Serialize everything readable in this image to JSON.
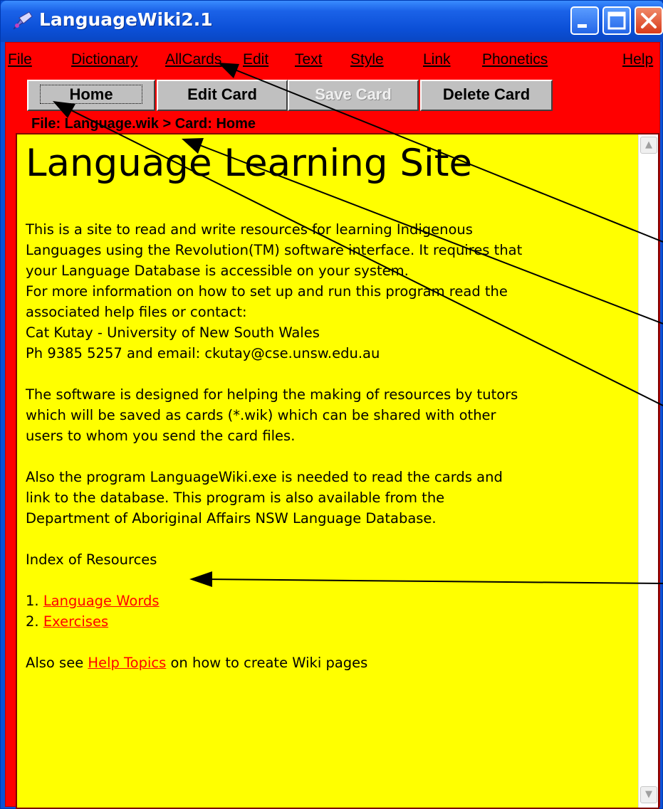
{
  "window": {
    "title": "LanguageWiki2.1",
    "colors": {
      "titlebar": "#0b4fd6",
      "client": "#ff0000",
      "card": "#ffff00",
      "link": "#ff0000"
    }
  },
  "icons": {
    "app": "app-icon",
    "minimize": "minimize-icon",
    "maximize": "maximize-icon",
    "close": "close-icon",
    "scroll_up": "scroll-up-arrow-icon",
    "scroll_down": "scroll-down-arrow-icon"
  },
  "menu": [
    {
      "label": "File"
    },
    {
      "label": "Dictionary"
    },
    {
      "label": "AllCards"
    },
    {
      "label": "Edit"
    },
    {
      "label": "Text"
    },
    {
      "label": "Style"
    },
    {
      "label": "Link"
    },
    {
      "label": "Phonetics"
    },
    {
      "label": "Help"
    }
  ],
  "toolbar": {
    "home": "Home",
    "edit_card": "Edit Card",
    "save_card": "Save Card",
    "delete_card": "Delete Card"
  },
  "breadcrumb": "File: Language.wik > Card: Home",
  "card": {
    "heading": "Language Learning Site",
    "lines": [
      "This is a site to read and write resources for learning Indigenous",
      "Languages using the Revolution(TM) software interface. It requires that",
      "your Language Database is accessible on your system.",
      "For more information on how to set up and run this program read the",
      "associated help files or contact:",
      "Cat Kutay - University of New South Wales",
      "Ph 9385 5257 and email: ckutay@cse.unsw.edu.au",
      "The software is designed for helping the making of resources by tutors",
      "which will be saved as cards (*.wik) which can be shared with other",
      "users to whom you send the card files.",
      "Also the program LanguageWiki.exe is needed to read the cards and",
      "link to the database. This program is also available from the",
      "Department of Aboriginal Affairs NSW Language Database.",
      "Index of Resources"
    ],
    "index": [
      {
        "number": "1.",
        "link": "Language Words"
      },
      {
        "number": "2.",
        "link": "Exercises"
      }
    ],
    "also_see": {
      "prefix": "Also see",
      "link": "Help Topics",
      "suffix": "on how to create Wiki pages"
    }
  }
}
